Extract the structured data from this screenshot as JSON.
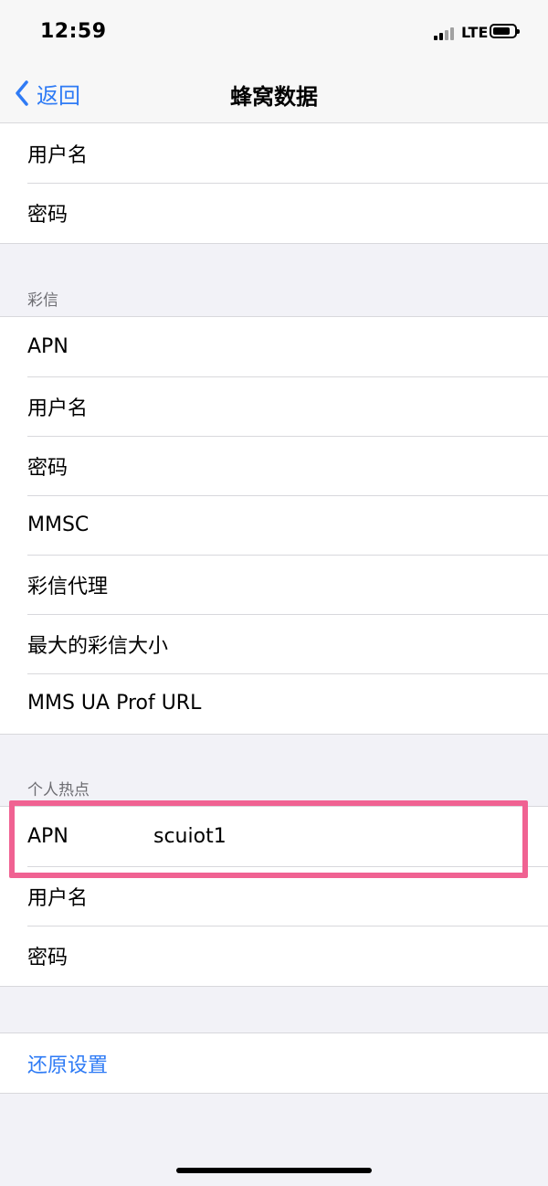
{
  "status_bar": {
    "time": "12:59",
    "network": "LTE"
  },
  "nav": {
    "back_label": "返回",
    "title": "蜂窝数据"
  },
  "top_group": {
    "items": [
      "用户名",
      "密码"
    ]
  },
  "mms": {
    "header": "彩信",
    "items": [
      "APN",
      "用户名",
      "密码",
      "MMSC",
      "彩信代理",
      "最大的彩信大小",
      "MMS UA Prof URL"
    ]
  },
  "hotspot": {
    "header": "个人热点",
    "apn_label": "APN",
    "apn_value": "scuiot1",
    "items": [
      "用户名",
      "密码"
    ]
  },
  "reset": {
    "label": "还原设置"
  },
  "colors": {
    "accent": "#2f7bf5",
    "highlight": "#f06292",
    "background": "#f2f2f7"
  }
}
